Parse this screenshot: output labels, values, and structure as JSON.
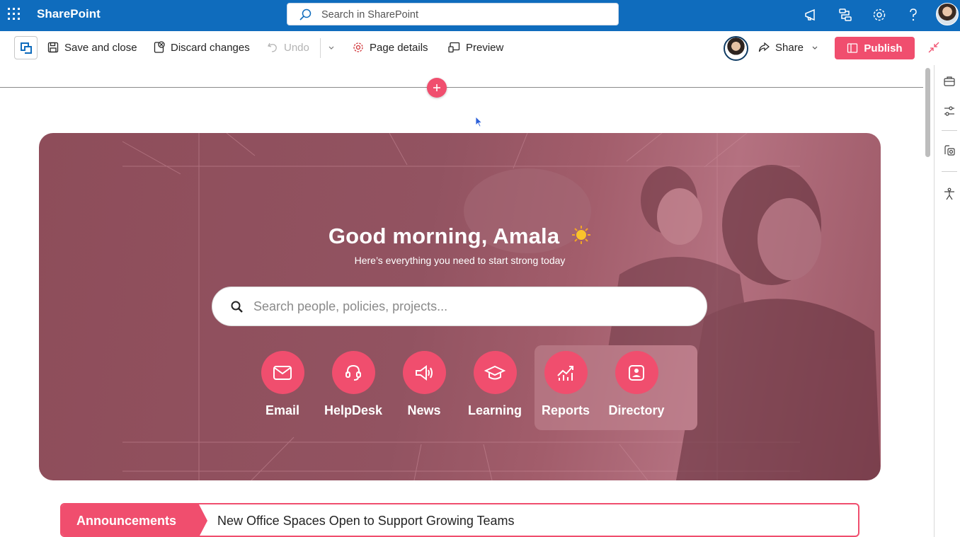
{
  "suite": {
    "brand": "SharePoint",
    "search_placeholder": "Search in SharePoint",
    "icons": [
      "waffle-icon",
      "megaphone-icon",
      "flow-icon",
      "settings-icon",
      "help-icon",
      "profile-avatar"
    ]
  },
  "command_bar": {
    "save_close": "Save and close",
    "discard": "Discard changes",
    "undo": "Undo",
    "page_details": "Page details",
    "preview": "Preview",
    "share": "Share",
    "publish": "Publish"
  },
  "hero": {
    "greeting": "Good morning, Amala",
    "subtitle": "Here’s everything you need to start strong today",
    "search_placeholder": "Search people, policies, projects...",
    "quick_links": [
      {
        "label": "Email",
        "icon": "mail-icon"
      },
      {
        "label": "HelpDesk",
        "icon": "headset-icon"
      },
      {
        "label": "News",
        "icon": "megaphone-icon"
      },
      {
        "label": "Learning",
        "icon": "graduation-cap-icon"
      },
      {
        "label": "Reports",
        "icon": "chart-icon"
      },
      {
        "label": "Directory",
        "icon": "contact-card-icon"
      }
    ]
  },
  "announcement": {
    "tag": "Announcements",
    "headline": "New Office Spaces Open to Support Growing Teams"
  },
  "colors": {
    "suite_blue": "#0f6cbd",
    "accent": "#f04e6e",
    "hero_tint": "#925361"
  }
}
